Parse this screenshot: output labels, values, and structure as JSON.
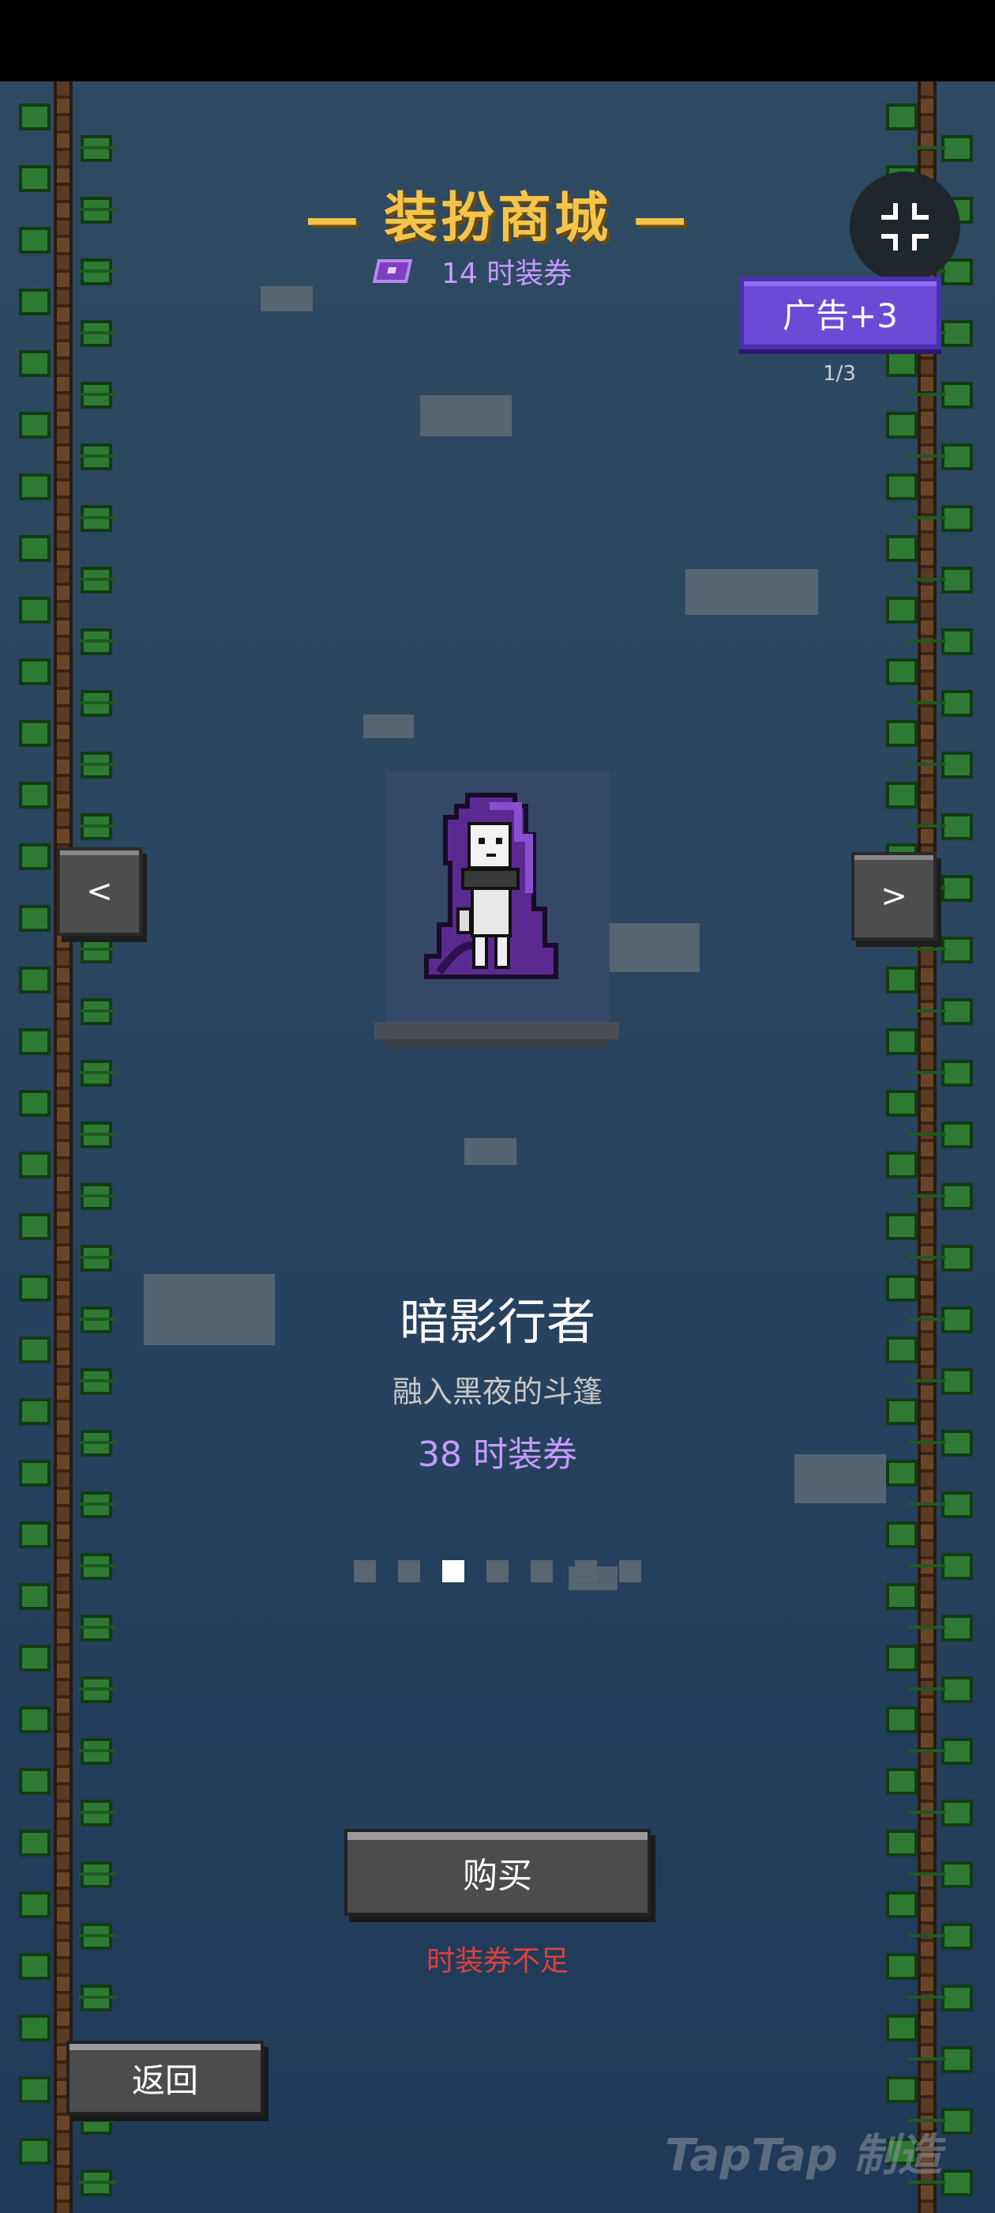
{
  "header": {
    "title": "— 装扮商城 —",
    "coupon_balance": "14 时装券"
  },
  "ad": {
    "button_label": "广告+3",
    "count": "1/3"
  },
  "carousel": {
    "prev_label": "<",
    "next_label": ">",
    "page_count": 7,
    "active_index": 2
  },
  "skin": {
    "name": "暗影行者",
    "description": "融入黑夜的斗篷",
    "price": "38 时装券"
  },
  "actions": {
    "buy_label": "购买",
    "warning": "时装券不足",
    "back_label": "返回"
  },
  "watermark": "TapTap 制造",
  "colors": {
    "title": "#f4c54a",
    "coupon": "#c59bff",
    "ad_button": "#6b4ad6",
    "warning": "#e0403a"
  }
}
